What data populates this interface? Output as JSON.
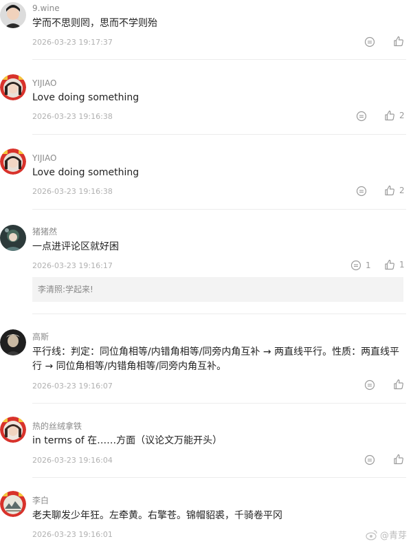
{
  "comments": [
    {
      "name": "9.wine",
      "text": "学而不思则罔，思而不学则殆",
      "time": "2026-03-23 19:17:37",
      "reply_count": "",
      "like_count": "",
      "avatar": "boy-avatar"
    },
    {
      "name": "YIJIAO",
      "text": "Love doing something",
      "time": "2026-03-23 19:16:38",
      "reply_count": "",
      "like_count": "2",
      "avatar": "girl-festive-avatar"
    },
    {
      "name": "YIJIAO",
      "text": "Love doing something",
      "time": "2026-03-23 19:16:38",
      "reply_count": "",
      "like_count": "2",
      "avatar": "girl-festive-avatar"
    },
    {
      "name": "猪猪然",
      "text": "一点进评论区就好困",
      "time": "2026-03-23 19:16:17",
      "reply_count": "1",
      "like_count": "1",
      "avatar": "anime-avatar",
      "reply": "李清照:学起来!"
    },
    {
      "name": "高斯",
      "text": "平行线：判定：同位角相等/内错角相等/同旁内角互补 → 两直线平行。性质：两直线平行 → 同位角相等/内错角相等/同旁内角互补。",
      "time": "2026-03-23 19:16:07",
      "reply_count": "",
      "like_count": "",
      "avatar": "portrait-avatar"
    },
    {
      "name": "热的丝绒拿铁",
      "text": "in terms of 在……方面（议论文万能开头）",
      "time": "2026-03-23 19:16:04",
      "reply_count": "",
      "like_count": "",
      "avatar": "girl-festive-avatar"
    },
    {
      "name": "李白",
      "text": "老夫聊发少年狂。左牵黄。右擎苍。锦帽貂裘，千骑卷平冈",
      "time": "2026-03-23 19:16:01",
      "reply_count": "",
      "like_count": "",
      "avatar": "painting-festive-avatar"
    }
  ],
  "watermark": {
    "text": "@青芽"
  },
  "colors": {
    "divider": "#ececec",
    "reply_bg": "#f3f3f3",
    "festive_red": "#d8322b"
  }
}
